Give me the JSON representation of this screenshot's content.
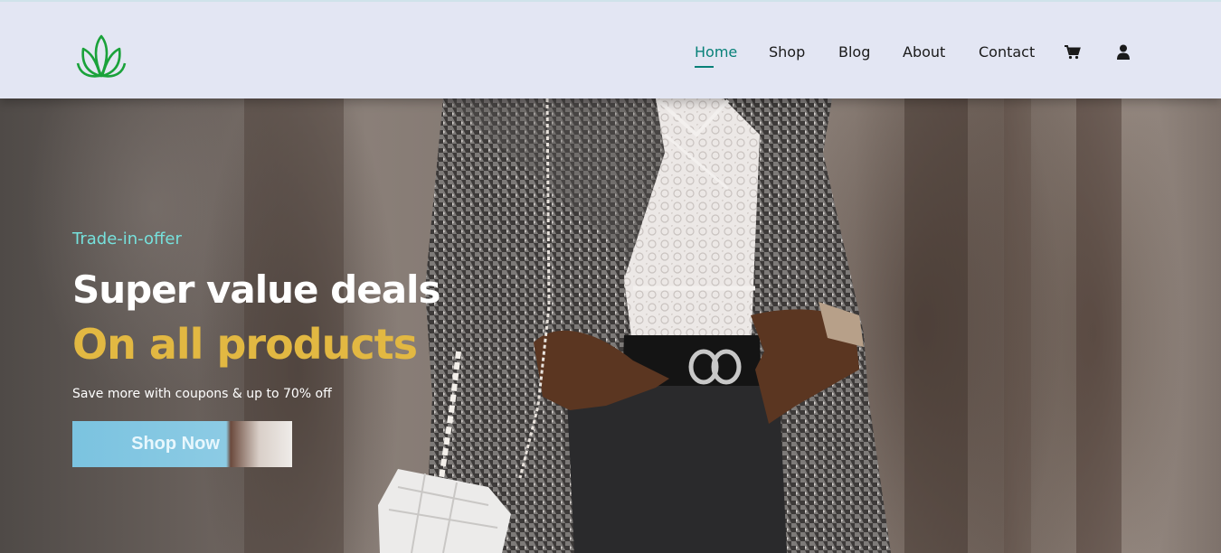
{
  "header": {
    "logo_icon": "lotus-icon",
    "brand_color": "#1aa23a",
    "nav": [
      {
        "label": "Home",
        "active": true
      },
      {
        "label": "Shop",
        "active": false
      },
      {
        "label": "Blog",
        "active": false
      },
      {
        "label": "About",
        "active": false
      },
      {
        "label": "Contact",
        "active": false
      }
    ],
    "icons": [
      "cart-icon",
      "user-icon"
    ],
    "active_color": "#088178"
  },
  "hero": {
    "tagline": "Trade-in-offer",
    "headline": "Super value deals",
    "subheadline": "On all products",
    "promo": "Save more with coupons & up to 70% off",
    "cta_label": "Shop Now",
    "colors": {
      "tagline": "#76e1dc",
      "subheadline": "#e2b842",
      "cta": "#8ccbe4"
    }
  }
}
